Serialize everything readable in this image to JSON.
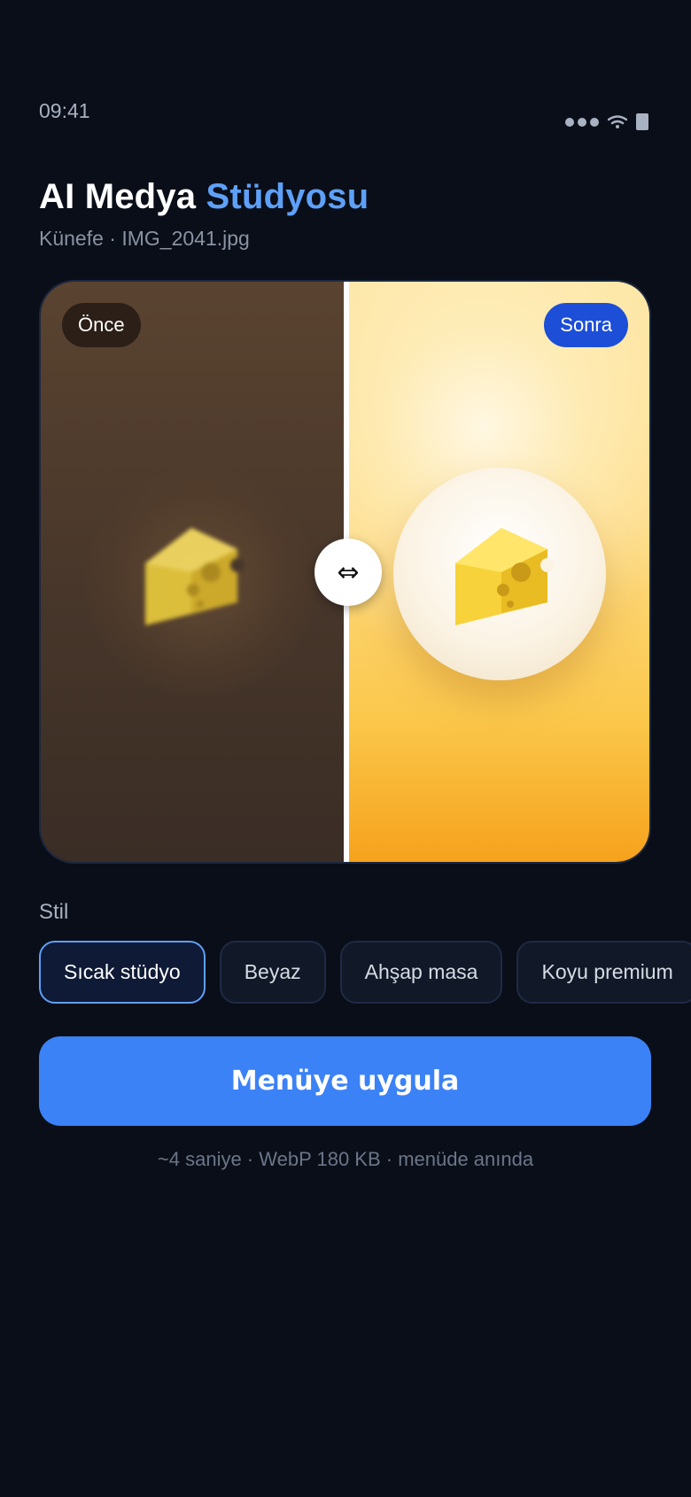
{
  "status_bar": {
    "time": "09:41"
  },
  "header": {
    "title_main": "AI Medya",
    "title_accent": "Stüdyosu",
    "subtitle": "Künefe · IMG_2041.jpg"
  },
  "compare": {
    "before_label": "Önce",
    "after_label": "Sonra",
    "handle_glyph": "⇔",
    "slider_position": 0.5
  },
  "styles": {
    "label": "Stil",
    "options": [
      "Sıcak stüdyo",
      "Beyaz",
      "Ahşap masa",
      "Koyu premium"
    ],
    "selected": "Sıcak stüdyo"
  },
  "cta": {
    "label": "Menüye uygula"
  },
  "meta": {
    "text": "~4 saniye · WebP 180 KB · menüde anında"
  },
  "colors": {
    "background": "#0a0e18",
    "accent": "#5ea0f8",
    "button": "#3b82f6",
    "after_badge": "#1d4ed8"
  },
  "icons": [
    "wifi-icon",
    "battery-icon",
    "signal-icon",
    "swap-arrows-icon",
    "cheese-icon"
  ]
}
